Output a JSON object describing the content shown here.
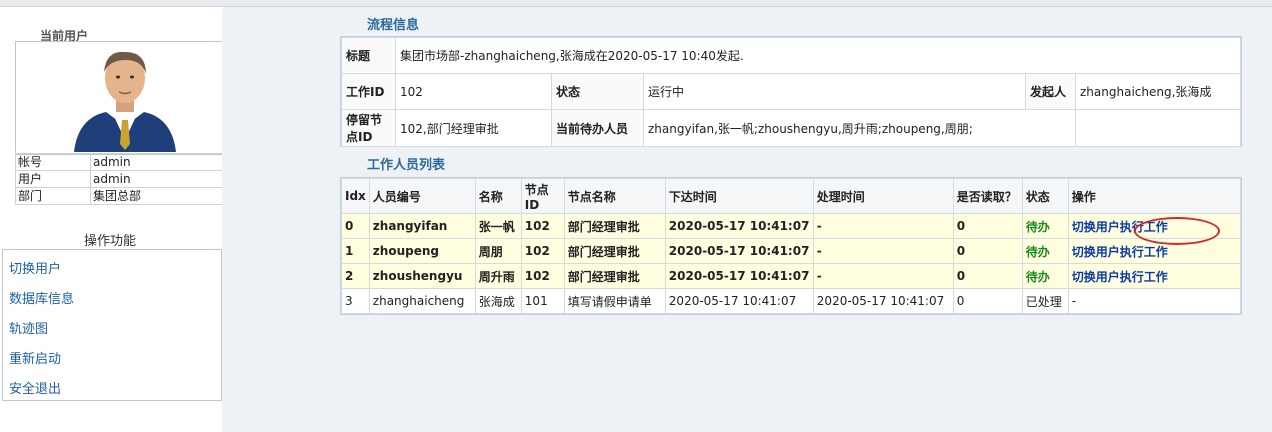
{
  "left_panel": {
    "current_user_title": "当前用户",
    "info": [
      {
        "key": "帐号",
        "value": "admin"
      },
      {
        "key": "用户",
        "value": "admin"
      },
      {
        "key": "部门",
        "value": "集团总部"
      }
    ],
    "functions_title": "操作功能",
    "functions": [
      "切换用户",
      "数据库信息",
      "轨迹图",
      "重新启动",
      "安全退出"
    ]
  },
  "flow_info": {
    "section_title": "流程信息",
    "title_label": "标题",
    "title_value": "集团市场部-zhanghaicheng,张海成在2020-05-17 10:40发起.",
    "work_id_label": "工作ID",
    "work_id_value": "102",
    "status_label": "状态",
    "status_value": "运行中",
    "initiator_label": "发起人",
    "initiator_value": "zhanghaicheng,张海成",
    "stay_node_label": "停留节点ID",
    "stay_node_value": "102,部门经理审批",
    "current_handlers_label": "当前待办人员",
    "current_handlers_value": "zhangyifan,张一帆;zhoushengyu,周升雨;zhoupeng,周朋;"
  },
  "worker_list": {
    "section_title": "工作人员列表",
    "columns": [
      "Idx",
      "人员编号",
      "名称",
      "节点ID",
      "节点名称",
      "下达时间",
      "处理时间",
      "是否读取？",
      "状态",
      "操作"
    ],
    "rows": [
      {
        "idx": "0",
        "emp_no": "zhangyifan",
        "name": "张一帆",
        "node_id": "102",
        "node_name": "部门经理审批",
        "issued": "2020-05-17 10:41:07",
        "processed": "-",
        "read": "0",
        "status": "待办",
        "op": "切换用户执行工作"
      },
      {
        "idx": "1",
        "emp_no": "zhoupeng",
        "name": "周朋",
        "node_id": "102",
        "node_name": "部门经理审批",
        "issued": "2020-05-17 10:41:07",
        "processed": "-",
        "read": "0",
        "status": "待办",
        "op": "切换用户执行工作"
      },
      {
        "idx": "2",
        "emp_no": "zhoushengyu",
        "name": "周升雨",
        "node_id": "102",
        "node_name": "部门经理审批",
        "issued": "2020-05-17 10:41:07",
        "processed": "-",
        "read": "0",
        "status": "待办",
        "op": "切换用户执行工作"
      },
      {
        "idx": "3",
        "emp_no": "zhanghaicheng",
        "name": "张海成",
        "node_id": "101",
        "node_name": "填写请假申请单",
        "issued": "2020-05-17 10:41:07",
        "processed": "2020-05-17 10:41:07",
        "read": "0",
        "status": "已处理",
        "op": "-"
      }
    ]
  },
  "colors": {
    "link": "#1f5fa6",
    "pending_status": "#1a8a1a",
    "pending_row": "#ffffe0",
    "section_title": "#2c6a9c",
    "annotation": "#d8262b"
  }
}
